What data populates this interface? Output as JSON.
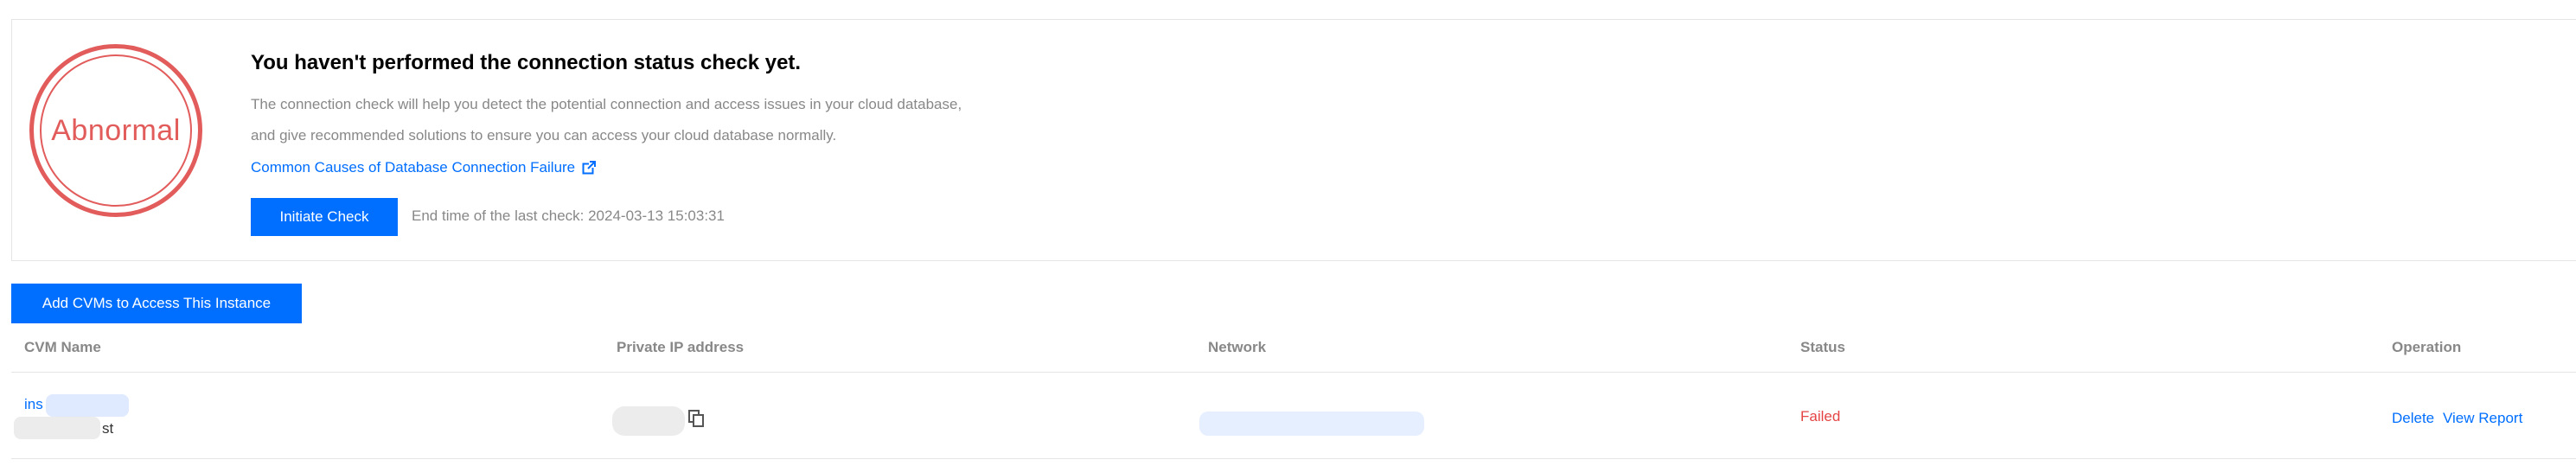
{
  "check_panel": {
    "badge_text": "Abnormal",
    "title": "You haven't performed the connection status check yet.",
    "description_line1": "The connection check will help you detect the potential connection and access issues in your cloud database,",
    "description_line2": "and give recommended solutions to ensure you can access your cloud database normally.",
    "link_text": "Common Causes of Database Connection Failure",
    "link_icon": "external-link-icon",
    "check_button": "Initiate Check",
    "last_check": "End time of the last check: 2024-03-13 15:03:31",
    "badge_color": "#e25c5c",
    "accent_color": "#006eff"
  },
  "toolbar": {
    "add_button": "Add CVMs to Access This Instance"
  },
  "table": {
    "columns": [
      "CVM Name",
      "Private IP address",
      "Network",
      "Status",
      "Operation"
    ],
    "rows": [
      {
        "cvm_name_visible": "ins",
        "cvm_sub_visible": "st",
        "status": "Failed",
        "status_color": "#e54545",
        "operations": [
          "Delete",
          "View Report"
        ]
      }
    ]
  }
}
